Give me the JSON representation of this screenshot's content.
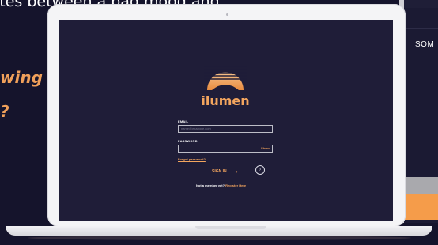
{
  "background": {
    "headline_fragment": "ites between a bad mood and",
    "accent_line1": "wing",
    "accent_line2": "?"
  },
  "right_device": {
    "section_label": "SOM"
  },
  "login": {
    "brand": "ilumen",
    "email_label": "EMAIL",
    "email_placeholder": "name@example.com",
    "password_label": "PASSWORD",
    "show_label": "Show",
    "forgot_label": "Forgot password?",
    "signin_label": "SIGN IN",
    "register_prompt": "Not a member yet?",
    "register_link": "Register Here"
  },
  "colors": {
    "background": "#15142c",
    "screen": "#1f1d38",
    "accent": "#f3a55e",
    "orange_bar": "#f59c4a"
  }
}
